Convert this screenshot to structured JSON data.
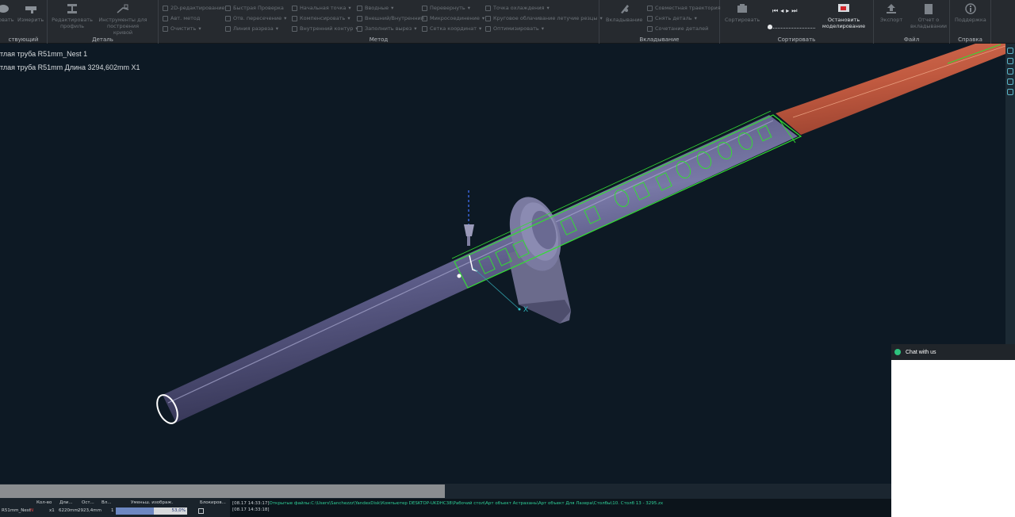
{
  "ribbon": {
    "groups": [
      {
        "label": "ствующий"
      },
      {
        "label": "Деталь"
      },
      {
        "label": "Метод"
      },
      {
        "label": "Вкладывание"
      },
      {
        "label": "Сортировать"
      },
      {
        "label": "Файл"
      },
      {
        "label": "Справка"
      }
    ],
    "buttons": {
      "zlb_cut": "ровать",
      "measure": "Измерить",
      "edit_profile": "Редактировать профиль",
      "curve_tools": "Инструменты для построения кривой",
      "edit_2d": "2D-редактирование",
      "auto_method": "Авт. метод",
      "clear": "Очистить",
      "quick_check": "Быстрая Проверка",
      "intersect_check": "Отв. пересечение",
      "cut_line": "Линия разреза",
      "start_point": "Начальная точка",
      "compensation": "Компенсировать",
      "inner_contour": "Внутренний контур",
      "lead_in": "Вводные",
      "outer_inner": "Внешний/Внутренний",
      "micro_joint": "Микросоединение",
      "fill_cut": "Заполнить вырез",
      "flip": "Перевернуть",
      "fill": "Заполнить",
      "grid_coords": "Сетка координат",
      "cool_point": "Точка охлаждения",
      "flying_cut": "Круговое облачивание летучие резцы",
      "optimize": "Оптимизировать",
      "nesting": "Вкладывание",
      "common_path": "Совместная траектория",
      "remove_part": "Снять деталь",
      "combine_parts": "Сочетание деталей",
      "sort": "Сортировать",
      "stop_sim": "Остановить моделирование",
      "export": "Экспорт",
      "nest_report": "Отчет о вкладывании",
      "support": "Поддержка"
    }
  },
  "viewport": {
    "part_name": "тлая труба R51mm_Nest 1",
    "part_info": "тлая труба R51mm Длина 3294,602mm  X1",
    "axis_x": "X"
  },
  "table": {
    "headers": [
      "Кол-во",
      "Дли...",
      "Ост...",
      "Вл...",
      "Уменьш. изображ.",
      "Блокиров..."
    ],
    "row": {
      "name": "R51mm_Nest",
      "flag": "N",
      "qty": "x1",
      "length": "6220mm",
      "remain": "2923,4mm",
      "nest": "1",
      "progress_label": "53,0%",
      "progress": 0.53
    }
  },
  "log": {
    "line1_time": "[08.17 14:33:17]",
    "line1_text": "Открытые файлы:C:\\Users\\Sanchezzz\\YandexDisk\\Компьютер DESKTOP-UKDHC38\\Рабочий стол\\Арт объект Астрахань\\Арт объект Для Лазера\\Столбы\\10. Столб 13 - 3295.zx",
    "line2_time": "[08.17 14:33:18]"
  },
  "chat": {
    "title": "Chat with us"
  },
  "colors": {
    "ribbon_bg": "#262a2f",
    "viewport_bg": "#0d1924",
    "pipe": "#5a5a86",
    "pipe_highlight": "#9c9cc2",
    "selection_green": "#33dd33",
    "remnant_orange": "#c35f45",
    "chat_online": "#2ec27e"
  }
}
